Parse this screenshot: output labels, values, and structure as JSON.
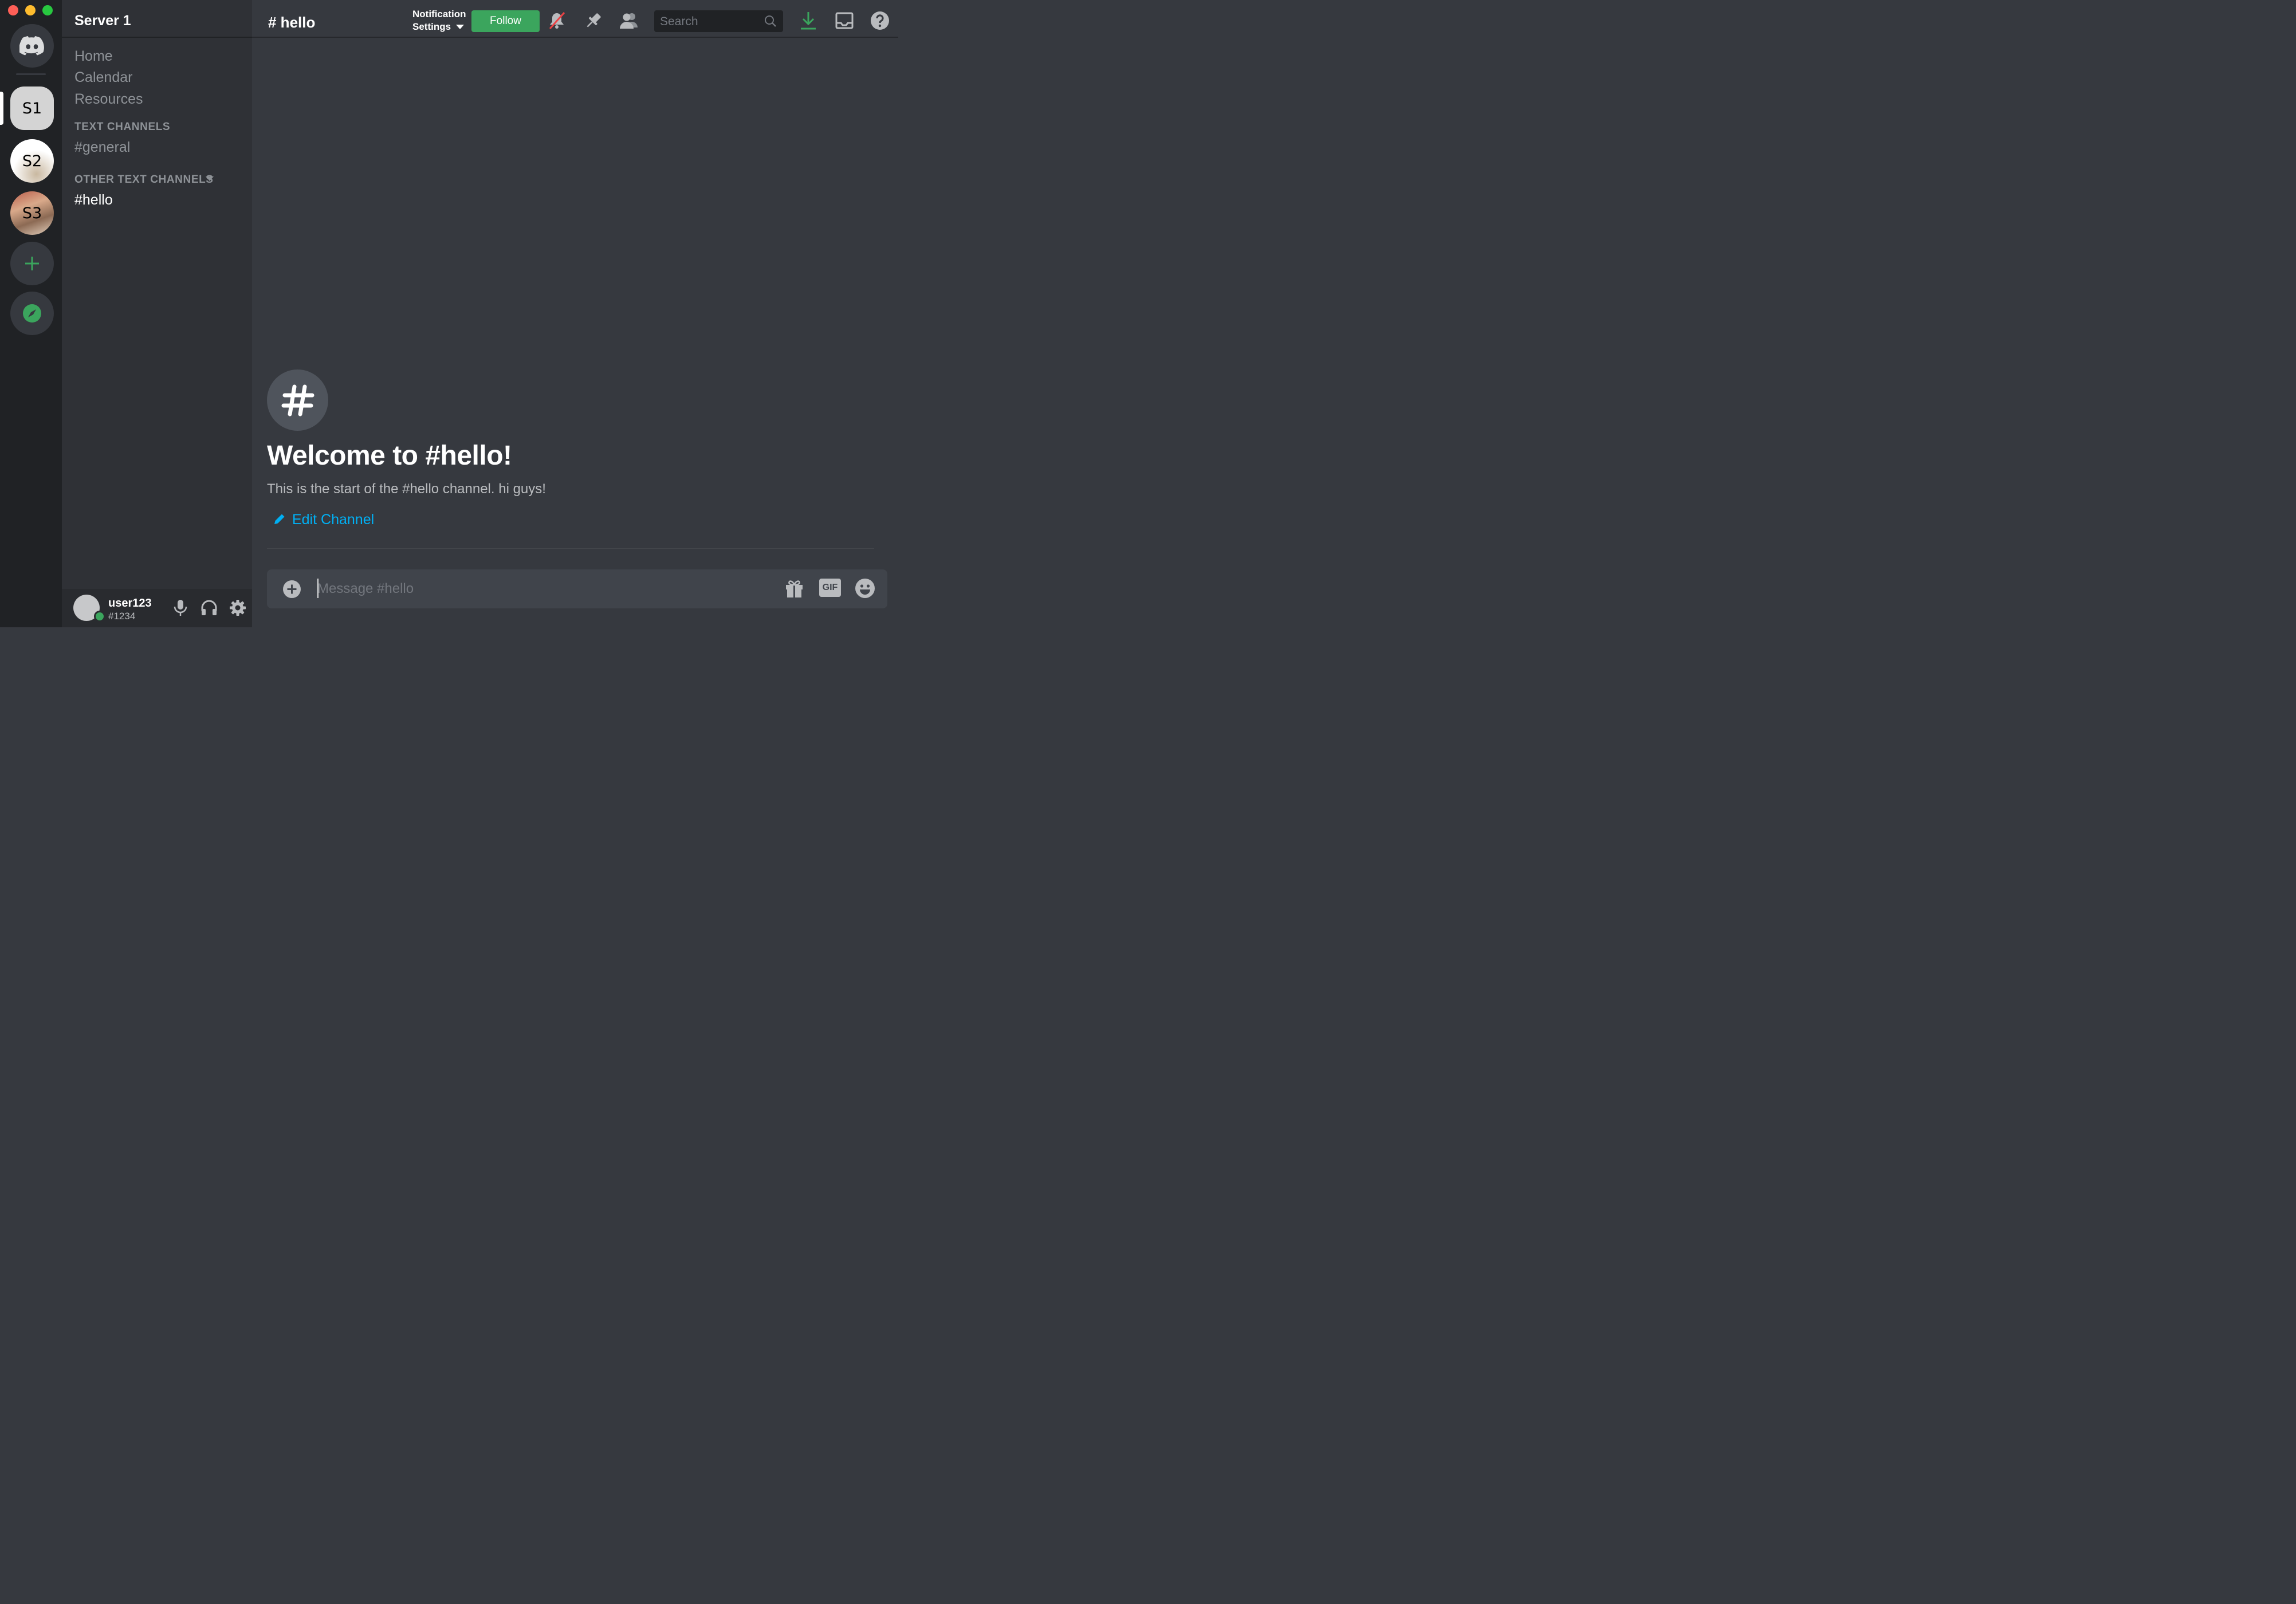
{
  "window": {
    "controls": [
      "close",
      "minimize",
      "maximize"
    ]
  },
  "servers": {
    "home_icon": "discord-logo-icon",
    "items": [
      {
        "label": "S1",
        "selected": true
      },
      {
        "label": "S2",
        "selected": false
      },
      {
        "label": "S3",
        "selected": false
      }
    ],
    "add_icon": "plus-icon",
    "explore_icon": "compass-icon"
  },
  "sidebar": {
    "server_name": "Server 1",
    "nav": [
      "Home",
      "Calendar",
      "Resources"
    ],
    "categories": [
      {
        "label": "TEXT CHANNELS",
        "channels": [
          "#general"
        ]
      },
      {
        "label": "OTHER TEXT CHANNELS",
        "channels": [
          "#hello"
        ]
      }
    ]
  },
  "user": {
    "name": "user123",
    "tag": "#1234",
    "status": "online"
  },
  "header": {
    "channel": "# hello",
    "notification_line1": "Notification",
    "notification_line2": "Settings",
    "follow_label": "Follow",
    "search_placeholder": "Search"
  },
  "welcome": {
    "title": "Welcome to #hello!",
    "description": "This is the start of the #hello channel. hi guys!",
    "edit_label": "Edit Channel"
  },
  "composer": {
    "placeholder": "Message #hello",
    "gif_label": "GIF"
  },
  "colors": {
    "accent_green": "#3ba55d",
    "link_blue": "#00b0f4",
    "bg_main": "#36393f",
    "bg_sidebar": "#2f3136",
    "bg_rail": "#202225"
  }
}
